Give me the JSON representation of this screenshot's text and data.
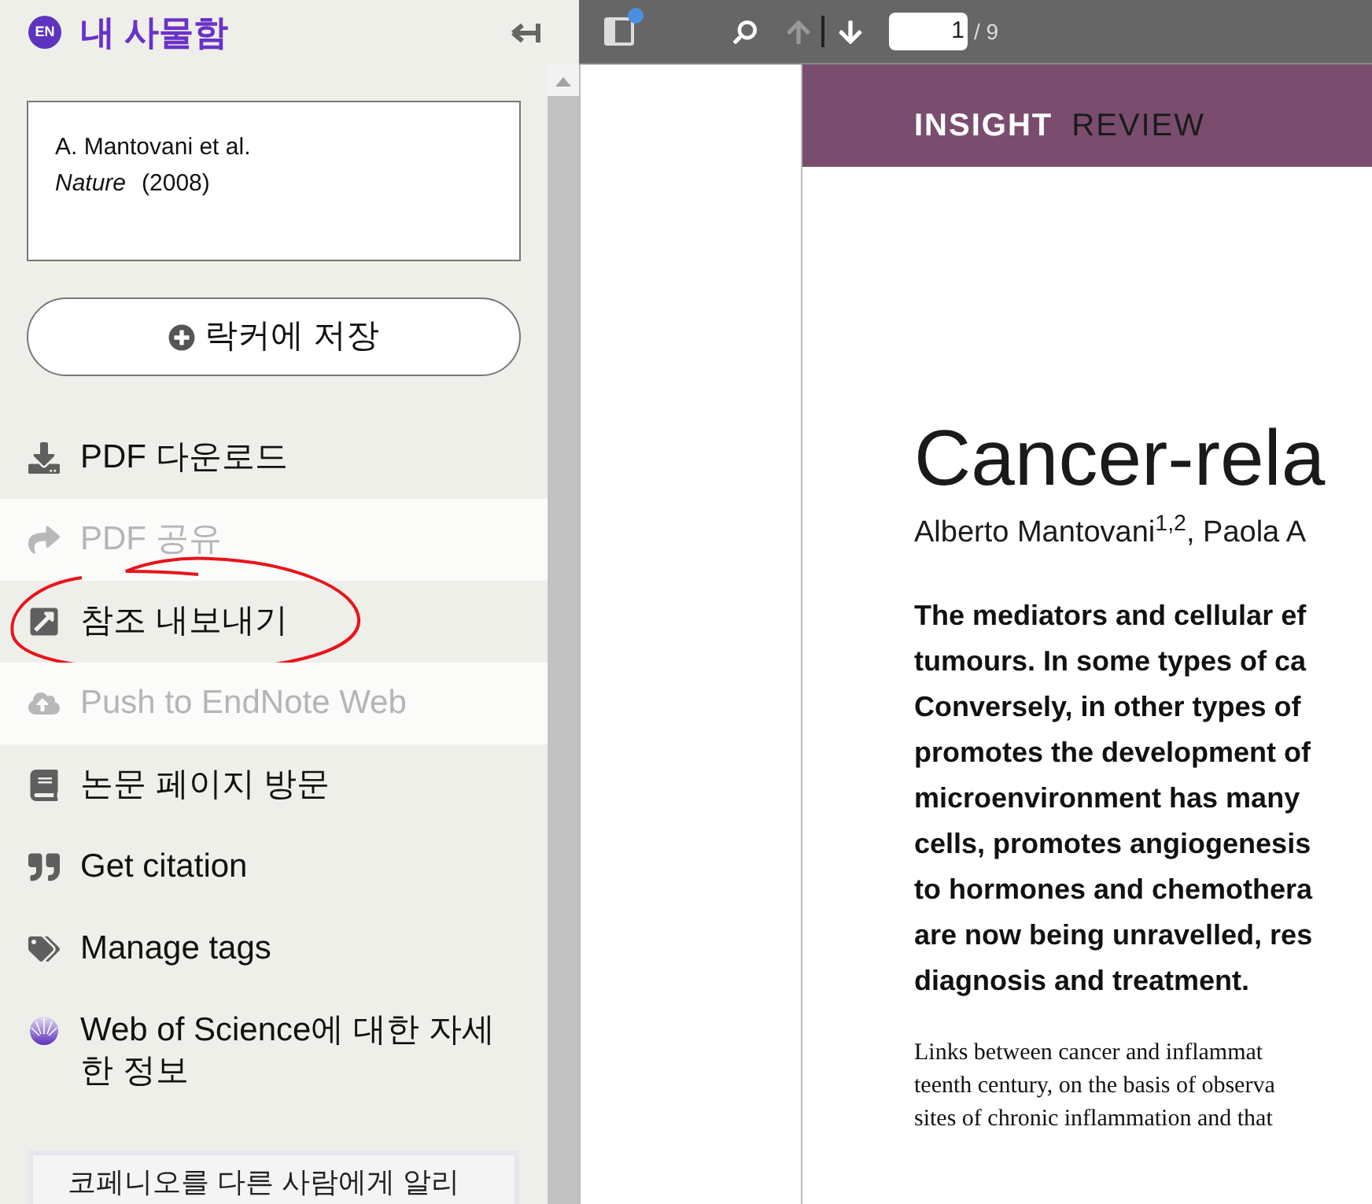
{
  "sidebar": {
    "language_badge": "EN",
    "title": "내 사물함",
    "citation": {
      "authors": "A. Mantovani et al.",
      "journal": "Nature",
      "year": "(2008)"
    },
    "save_button": "락커에 저장",
    "actions": [
      {
        "label": "PDF 다운로드",
        "disabled": false,
        "circled": false
      },
      {
        "label": "PDF 공유",
        "disabled": true,
        "circled": false
      },
      {
        "label": "참조 내보내기",
        "disabled": false,
        "circled": true
      },
      {
        "label": "Push to EndNote Web",
        "disabled": true,
        "circled": false
      },
      {
        "label": "논문 페이지 방문",
        "disabled": false,
        "circled": false
      },
      {
        "label": "Get citation",
        "disabled": false,
        "circled": false
      },
      {
        "label": "Manage tags",
        "disabled": false,
        "circled": false
      },
      {
        "label": "Web of Science에 대한 자세한 정보",
        "disabled": false,
        "circled": false
      }
    ],
    "promo_text": "코페니오를 다른 사람에게 알리"
  },
  "annotation": {
    "color": "#e8141b"
  },
  "viewer": {
    "sidebar_toggle_badge": true,
    "prev_disabled": true,
    "next_disabled": false,
    "page_input": "1",
    "page_total": "/ 9",
    "header": {
      "section": "INSIGHT",
      "type": "REVIEW"
    },
    "title": "Cancer-rela",
    "authors": "Alberto Mantovani$^{1,2}$, Paola A",
    "abstract_lines": [
      "The mediators and cellular ef",
      "tumours. In some types of ca",
      "Conversely, in other types of",
      "promotes the development of",
      "microenvironment has many",
      "cells, promotes angiogenesis",
      "to hormones and chemothera",
      "are now being unravelled, res",
      "diagnosis and treatment."
    ],
    "body_lines": [
      "Links between cancer and inflammat",
      "teenth century, on the basis of observa",
      "sites of chronic inflammation and that"
    ]
  }
}
